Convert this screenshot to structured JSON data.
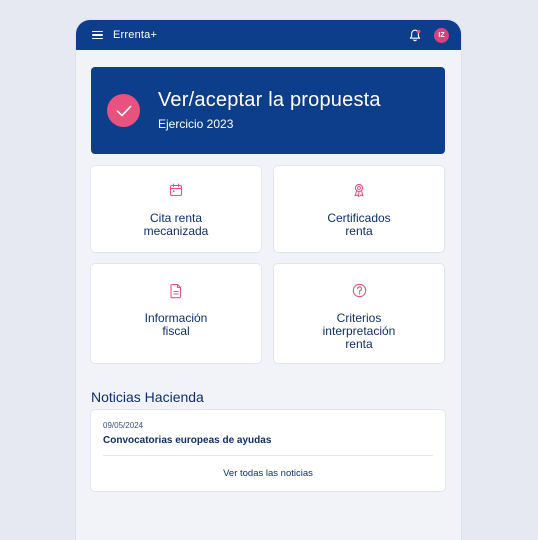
{
  "app": {
    "title": "Errenta+",
    "avatar_initials": "IZ",
    "icons": {
      "menu": "hamburger-menu-icon",
      "notifications": "bell-icon"
    }
  },
  "hero": {
    "title": "Ver/aceptar la propuesta",
    "subtitle": "Ejercicio 2023",
    "icon": "check-circle-icon"
  },
  "tiles": [
    {
      "label": "Cita renta\nmecanizada",
      "icon": "calendar-icon"
    },
    {
      "label": "Certificados\nrenta",
      "icon": "award-ribbon-icon"
    },
    {
      "label": "Información\nfiscal",
      "icon": "document-icon"
    },
    {
      "label": "Criterios\ninterpretación\nrenta",
      "icon": "help-circle-icon"
    }
  ],
  "news": {
    "heading": "Noticias Hacienda",
    "items": [
      {
        "date": "09/05/2024",
        "title": "Convocatorias europeas de ayudas"
      }
    ],
    "see_all_label": "Ver todas las noticias"
  },
  "colors": {
    "primary": "#0c3e8c",
    "accent": "#e8527f",
    "background": "#e6e9f2"
  }
}
